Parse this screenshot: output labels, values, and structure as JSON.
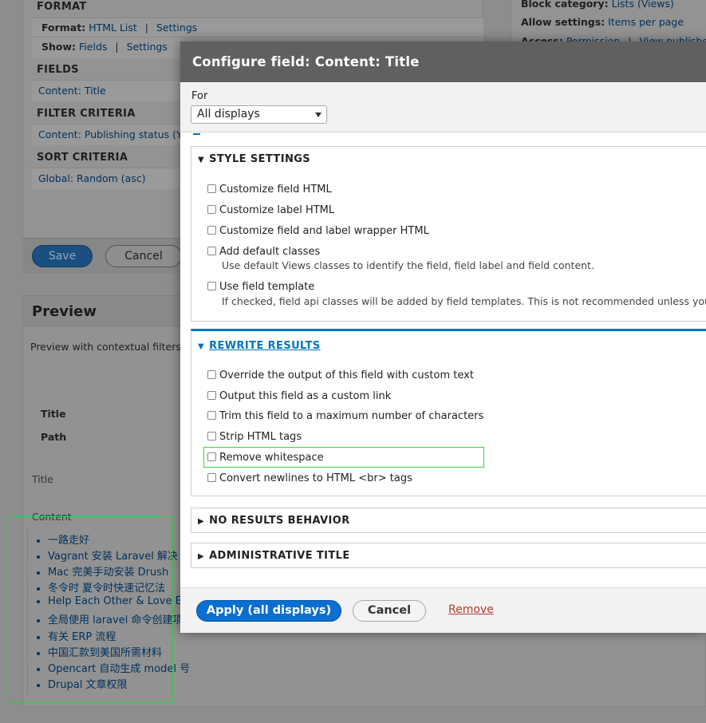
{
  "background": {
    "format": {
      "heading": "FORMAT",
      "format_label": "Format:",
      "format_value": "HTML List",
      "format_settings": "Settings",
      "show_label": "Show:",
      "show_value": "Fields",
      "show_settings": "Settings"
    },
    "fields": {
      "heading": "FIELDS",
      "item": "Content: Title"
    },
    "filter": {
      "heading": "FILTER CRITERIA",
      "item": "Content: Publishing status (Ye"
    },
    "sort": {
      "heading": "SORT CRITERIA",
      "item": "Global: Random (asc)"
    },
    "right": {
      "block_category_label": "Block category:",
      "block_category_value": "Lists (Views)",
      "allow_settings_label": "Allow settings:",
      "allow_settings_value": "Items per page",
      "access_label": "Access:",
      "access_value": "Permission",
      "access_extra": "View published"
    },
    "save_button": "Save",
    "cancel_button": "Cancel",
    "preview": {
      "heading": "Preview",
      "contextual": "Preview with contextual filters",
      "title_label": "Title",
      "path_label": "Path",
      "title_row": "Title",
      "content_label": "Content",
      "list": [
        "一路走好",
        "Vagrant 安装 Laravel 解决",
        "Mac 完美手动安装 Drush",
        "冬令时 夏令时快速记忆法",
        "Help Each Other & Love Ea",
        "全局使用 laravel 命令创建项",
        "有关 ERP 流程",
        "中国汇款到美国所需材料",
        "Opencart 自动生成 model 号",
        "Drupal 文章权限"
      ]
    }
  },
  "modal": {
    "title": "Configure field: Content: Title",
    "for_label": "For",
    "for_select": "All displays",
    "style_settings": {
      "legend": "STYLE SETTINGS",
      "options": [
        "Customize field HTML",
        "Customize label HTML",
        "Customize field and label wrapper HTML",
        "Add default classes",
        "Use field template"
      ],
      "add_default_desc": "Use default Views classes to identify the field, field label and field content.",
      "field_template_desc": "If checked, field api classes will be added by field templates. This is not recommended unless your CS"
    },
    "rewrite_results": {
      "legend": "REWRITE RESULTS",
      "options": [
        "Override the output of this field with custom text",
        "Output this field as a custom link",
        "Trim this field to a maximum number of characters",
        "Strip HTML tags",
        "Remove whitespace",
        "Convert newlines to HTML <br> tags"
      ]
    },
    "no_results": {
      "legend": "NO RESULTS BEHAVIOR"
    },
    "admin_title": {
      "legend": "ADMINISTRATIVE TITLE"
    },
    "apply_button": "Apply (all displays)",
    "cancel_button": "Cancel",
    "remove_link": "Remove"
  },
  "colors": {
    "accent": "#0074bd",
    "primary_button": "#0a6fd0",
    "remove_link": "#c0392b",
    "highlight_outline": "#39d34a",
    "modal_titlebar": "#606060"
  }
}
